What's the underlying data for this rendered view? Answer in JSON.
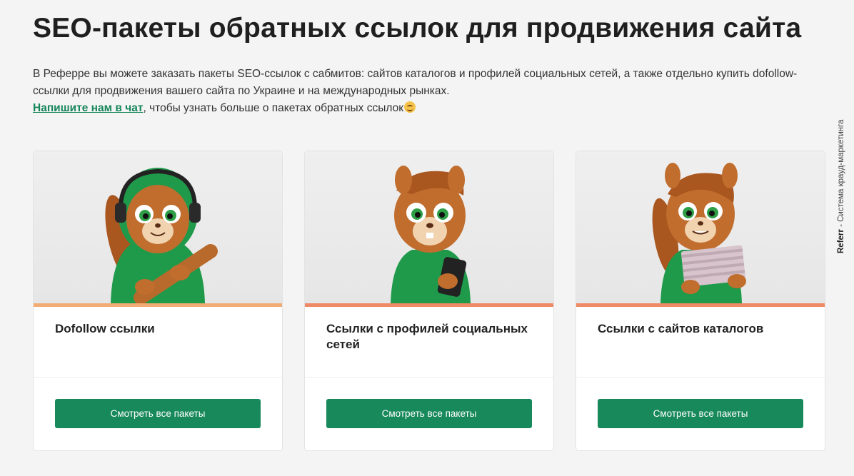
{
  "page": {
    "title": "SEO-пакеты обратных ссылок для продвижения сайта",
    "intro_line1": "В Реферре вы можете заказать пакеты SEO-ссылок с сабмитов: сайтов каталогов и профилей социальных сетей, а также отдельно купить dofollow-ссылки для продвижения вашего сайта по Украине и на международных рынках.",
    "chat_link": "Напишите нам в чат",
    "chat_rest": ", чтобы узнать больше о пакетах обратных ссылок"
  },
  "side_label": {
    "brand": "Referr",
    "text": " - Система крауд-маркетинга"
  },
  "cards": [
    {
      "title": "Dofollow ссылки",
      "button": "Смотреть все пакеты",
      "image_icon": "squirrel-with-headphones-and-bat-icon",
      "stripe_color": "#f2ad77"
    },
    {
      "title": "Ссылки с профилей социальных сетей",
      "button": "Смотреть все пакеты",
      "image_icon": "squirrel-with-phone-icon",
      "stripe_color": "#ef8a66"
    },
    {
      "title": "Ссылки с сайтов каталогов",
      "button": "Смотреть все пакеты",
      "image_icon": "squirrel-with-cards-icon",
      "stripe_color": "#ef8a66"
    }
  ],
  "colors": {
    "accent": "#17895b",
    "link": "#16865a",
    "hoodie": "#1f9a4a",
    "fur": "#b9652a"
  }
}
